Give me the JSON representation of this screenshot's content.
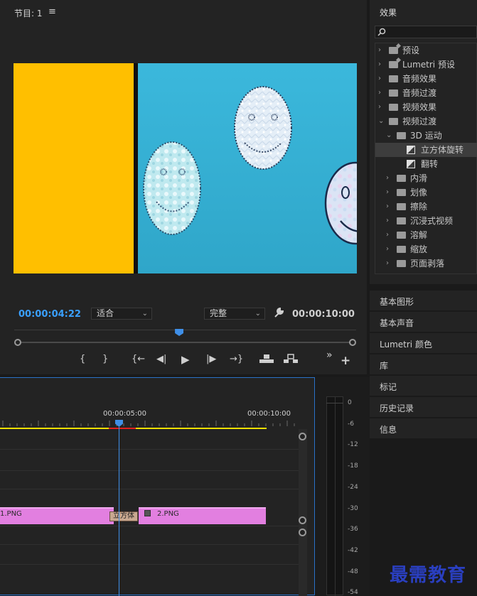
{
  "program_monitor": {
    "title": "节目: 1",
    "menu_glyph": "≡",
    "current_timecode": "00:00:04:22",
    "fit_dropdown": "适合",
    "quality_dropdown": "完整",
    "duration_timecode": "00:00:10:00",
    "playhead_progress": 0.48,
    "controls": {
      "mark_in": "{",
      "mark_out": "}",
      "go_to_in": "{←",
      "step_back": "◀|",
      "play": "▶",
      "step_forward": "|▶",
      "go_to_out": "→}",
      "lift": "lift-icon",
      "extract": "extract-icon",
      "more": "»",
      "add": "+"
    }
  },
  "effects_panel": {
    "title": "效果",
    "search_placeholder": "",
    "items": [
      {
        "label": "预设",
        "icon": "preset-folder-icon",
        "depth": 0,
        "expanded": false
      },
      {
        "label": "Lumetri 预设",
        "icon": "preset-folder-icon",
        "depth": 0,
        "expanded": false
      },
      {
        "label": "音频效果",
        "icon": "folder-icon",
        "depth": 0,
        "expanded": false
      },
      {
        "label": "音频过渡",
        "icon": "folder-icon",
        "depth": 0,
        "expanded": false
      },
      {
        "label": "视频效果",
        "icon": "folder-icon",
        "depth": 0,
        "expanded": false
      },
      {
        "label": "视频过渡",
        "icon": "folder-icon",
        "depth": 0,
        "expanded": true
      },
      {
        "label": "3D 运动",
        "icon": "folder-icon",
        "depth": 1,
        "expanded": true
      },
      {
        "label": "立方体旋转",
        "icon": "transition-icon",
        "depth": 2,
        "selected": true
      },
      {
        "label": "翻转",
        "icon": "transition-icon",
        "depth": 2
      },
      {
        "label": "内滑",
        "icon": "folder-icon",
        "depth": 1,
        "expanded": false
      },
      {
        "label": "划像",
        "icon": "folder-icon",
        "depth": 1,
        "expanded": false
      },
      {
        "label": "擦除",
        "icon": "folder-icon",
        "depth": 1,
        "expanded": false
      },
      {
        "label": "沉浸式视频",
        "icon": "folder-icon",
        "depth": 1,
        "expanded": false
      },
      {
        "label": "溶解",
        "icon": "folder-icon",
        "depth": 1,
        "expanded": false
      },
      {
        "label": "缩放",
        "icon": "folder-icon",
        "depth": 1,
        "expanded": false
      },
      {
        "label": "页面剥落",
        "icon": "folder-icon",
        "depth": 1,
        "expanded": false
      }
    ]
  },
  "side_panels": [
    "基本图形",
    "基本声音",
    "Lumetri 颜色",
    "库",
    "标记",
    "历史记录",
    "信息"
  ],
  "timeline": {
    "ruler_labels": [
      "00:00:05:00",
      "00:00:10:00"
    ],
    "clip_1": "1.PNG",
    "clip_2": "2.PNG",
    "transition_label": "立方体"
  },
  "audio_meter": {
    "db_labels": [
      "0",
      "-6",
      "-12",
      "-18",
      "-24",
      "-30",
      "-36",
      "-42",
      "-48",
      "-54"
    ]
  },
  "watermark": "最需教育",
  "colors": {
    "accent_blue": "#3aa0ff",
    "clip_pink": "#e27fe0",
    "work_area_yellow": "#f0e000",
    "viewer_yellow": "#ffbf00",
    "viewer_blue": "#34b0d6"
  }
}
